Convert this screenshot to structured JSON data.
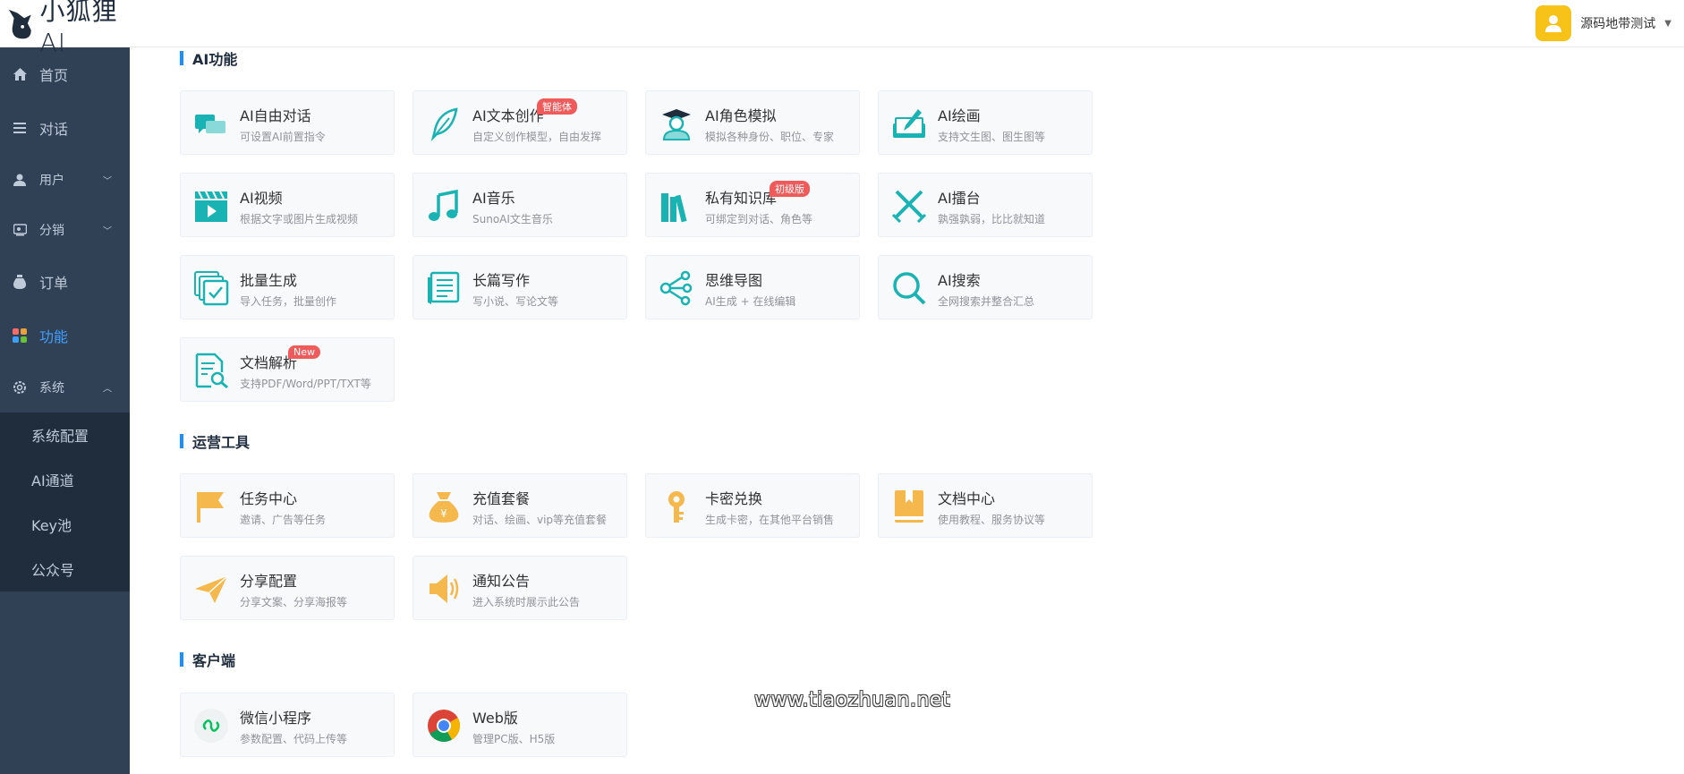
{
  "header": {
    "logo_text": "小狐狸AI",
    "user_name": "源码地带测试"
  },
  "sidebar": {
    "items": [
      {
        "label": "首页"
      },
      {
        "label": "对话"
      },
      {
        "label": "用户"
      },
      {
        "label": "分销"
      },
      {
        "label": "订单"
      },
      {
        "label": "功能"
      },
      {
        "label": "系统"
      }
    ],
    "system_sub": [
      {
        "label": "系统配置"
      },
      {
        "label": "AI通道"
      },
      {
        "label": "Key池"
      },
      {
        "label": "公众号"
      }
    ]
  },
  "sections": {
    "ai": {
      "title": "AI功能",
      "cards": [
        {
          "title": "AI自由对话",
          "desc": "可设置AI前置指令"
        },
        {
          "title": "AI文本创作",
          "desc": "自定义创作模型，自由发挥",
          "badge": "智能体"
        },
        {
          "title": "AI角色模拟",
          "desc": "模拟各种身份、职位、专家"
        },
        {
          "title": "AI绘画",
          "desc": "支持文生图、图生图等"
        },
        {
          "title": "AI视频",
          "desc": "根据文字或图片生成视频"
        },
        {
          "title": "AI音乐",
          "desc": "SunoAI文生音乐"
        },
        {
          "title": "私有知识库",
          "desc": "可绑定到对话、角色等",
          "badge": "初级版"
        },
        {
          "title": "AI擂台",
          "desc": "孰强孰弱，比比就知道"
        },
        {
          "title": "批量生成",
          "desc": "导入任务，批量创作"
        },
        {
          "title": "长篇写作",
          "desc": "写小说、写论文等"
        },
        {
          "title": "思维导图",
          "desc": "AI生成 + 在线编辑"
        },
        {
          "title": "AI搜索",
          "desc": "全网搜索并整合汇总"
        },
        {
          "title": "文档解析",
          "desc": "支持PDF/Word/PPT/TXT等",
          "badge": "New"
        }
      ]
    },
    "ops": {
      "title": "运营工具",
      "cards": [
        {
          "title": "任务中心",
          "desc": "邀请、广告等任务"
        },
        {
          "title": "充值套餐",
          "desc": "对话、绘画、vip等充值套餐"
        },
        {
          "title": "卡密兑换",
          "desc": "生成卡密，在其他平台销售"
        },
        {
          "title": "文档中心",
          "desc": "使用教程、服务协议等"
        },
        {
          "title": "分享配置",
          "desc": "分享文案、分享海报等"
        },
        {
          "title": "通知公告",
          "desc": "进入系统时展示此公告"
        }
      ]
    },
    "client": {
      "title": "客户端",
      "cards": [
        {
          "title": "微信小程序",
          "desc": "参数配置、代码上传等"
        },
        {
          "title": "Web版",
          "desc": "管理PC版、H5版"
        }
      ]
    }
  },
  "watermark": "www.tiaozhuan.net",
  "colors": {
    "sidebar_bg": "#304156",
    "submenu_bg": "#1f2d3d",
    "active": "#409eff",
    "teal_icon": "#1ab3b3",
    "orange_icon": "#f5b84c",
    "badge": "#ef5b5b"
  }
}
